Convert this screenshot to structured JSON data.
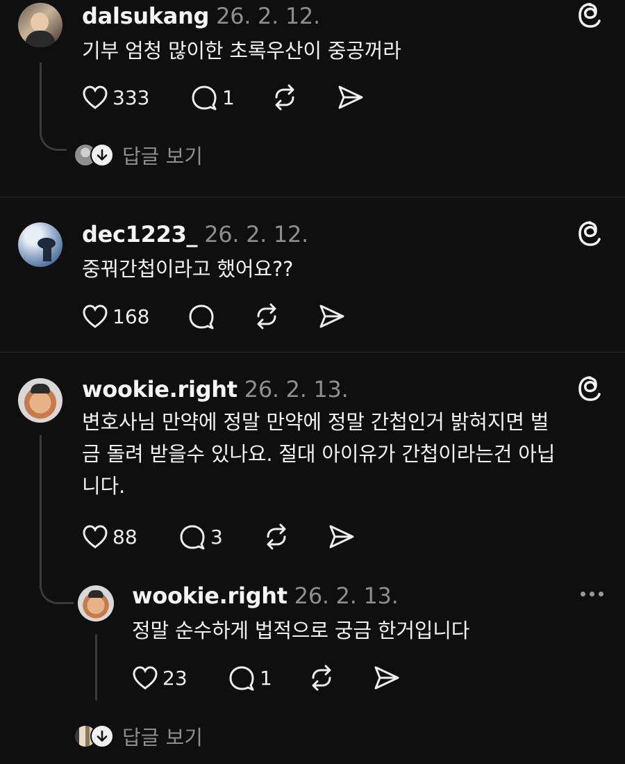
{
  "comments": [
    {
      "username": "dalsukang",
      "date": "26. 2. 12.",
      "text": "기부 엄청 많이한 초록우산이 중공꺼라",
      "likes": "333",
      "replies": "1"
    },
    {
      "username": "dec1223_",
      "date": "26. 2. 12.",
      "text": "중꿔간첩이라고 했어요??",
      "likes": "168",
      "replies": ""
    },
    {
      "username": "wookie.right",
      "date": "26. 2. 13.",
      "text_lines": [
        "변호사님 만약에 정말 만약에 정말 간첩인거 밝혀지면 벌",
        "금 돌려 받을수 있나요. 절대 아이유가 간첩이라는건 아닙",
        "니다."
      ],
      "likes": "88",
      "replies": "3",
      "reply": {
        "username": "wookie.right",
        "date": "26. 2. 13.",
        "text": "정말 순수하게 법적으로 궁금 한거입니다",
        "likes": "23",
        "replies": "1"
      }
    }
  ],
  "view_replies_label": "답글 보기",
  "icons": {
    "like": "heart-icon",
    "comment": "comment-icon",
    "repost": "repost-icon",
    "share": "share-icon",
    "threads": "threads-logo-icon",
    "more": "more-icon"
  }
}
